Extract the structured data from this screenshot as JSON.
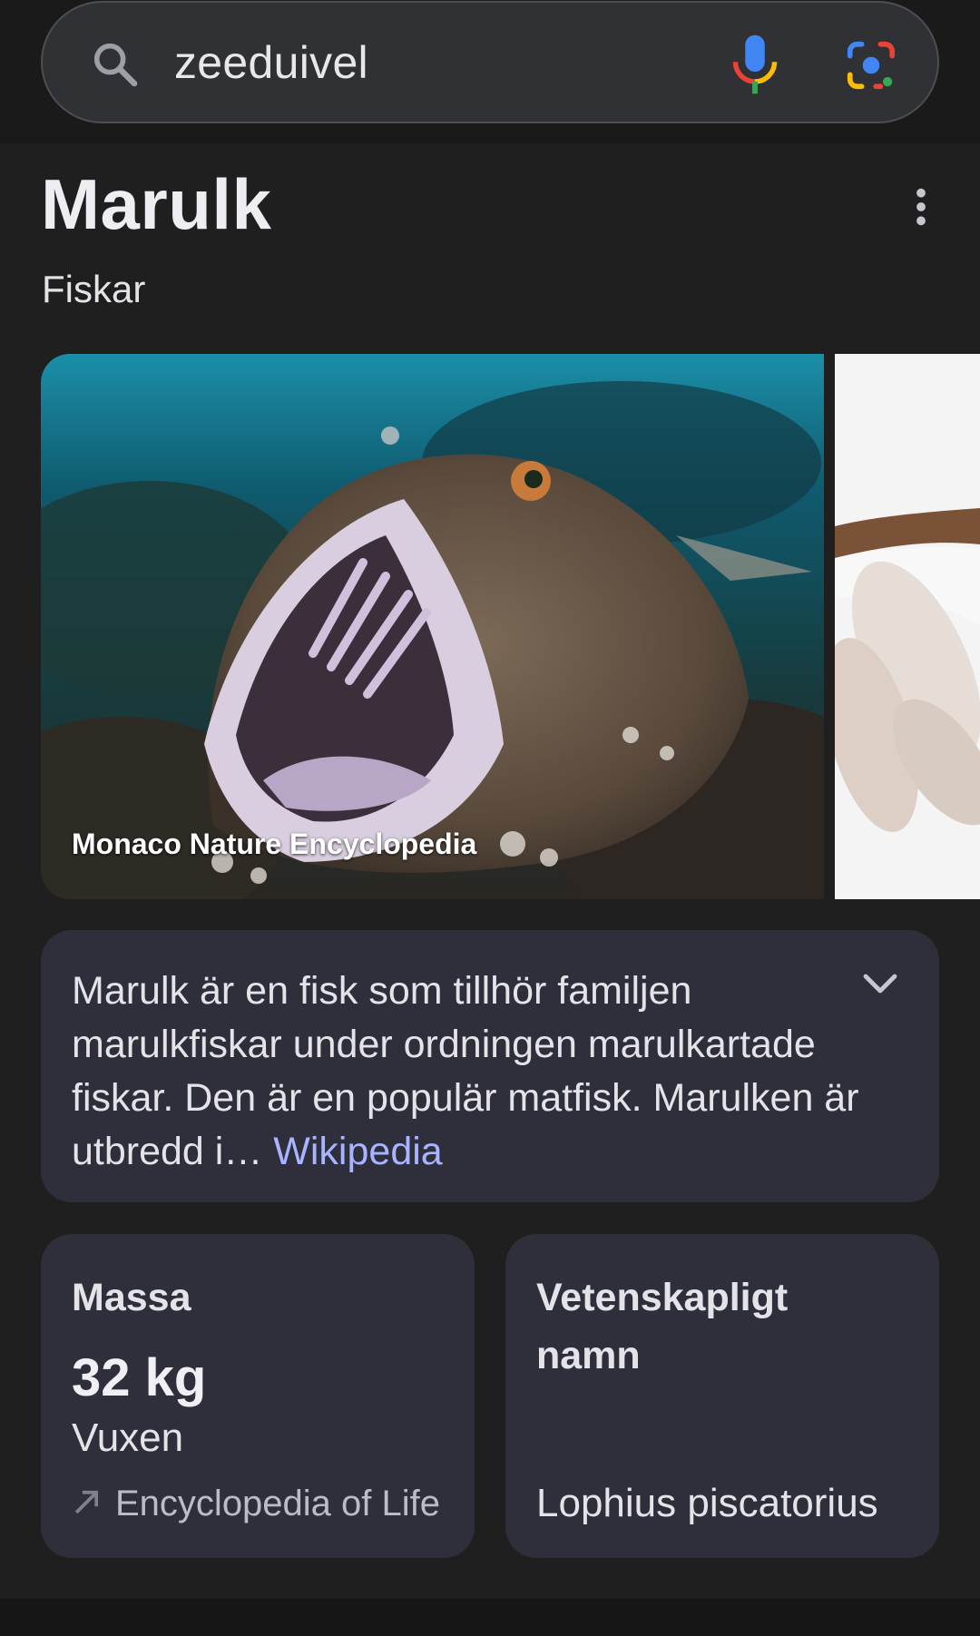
{
  "search": {
    "query": "zeeduivel",
    "icons": [
      "search-icon",
      "mic-icon",
      "google-lens-icon"
    ]
  },
  "entity": {
    "title": "Marulk",
    "subtitle": "Fiskar",
    "menu_icon": "more-vert-icon"
  },
  "images": {
    "main_caption": "Monaco Nature Encyclopedia"
  },
  "description": {
    "text": "Marulk är en fisk som tillhör familjen marulkfiskar under ordningen marulkartade fiskar. Den är en populär matfisk. Marulken är utbredd i…",
    "source": "Wikipedia",
    "expand_icon": "chevron-down-icon"
  },
  "facts": {
    "mass": {
      "label": "Massa",
      "value": "32 kg",
      "qualifier": "Vuxen",
      "source": "Encyclopedia of Life"
    },
    "scientific_name": {
      "label": "Vetenskapligt namn",
      "value": "Lophius piscatorius"
    }
  },
  "colors": {
    "background": "#1f1f1f",
    "card": "#2e2f3a",
    "link": "#a8b4ff"
  }
}
